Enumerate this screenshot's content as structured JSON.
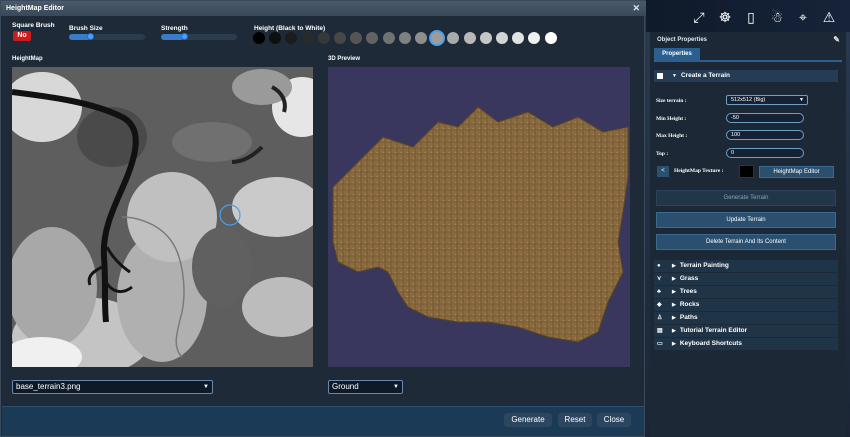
{
  "editor": {
    "title": "HeightMap Editor",
    "square_brush_label": "Square Brush",
    "square_brush_value": "No",
    "brush_size_label": "Brush Size",
    "brush_size_level": 0.28,
    "strength_label": "Strength",
    "strength_level": 0.3,
    "height_label": "Height (Black to White)",
    "height_swatches": [
      "#000000",
      "#0f0f0f",
      "#1c1c1c",
      "#2a2a2a",
      "#383838",
      "#474747",
      "#555555",
      "#636363",
      "#727272",
      "#808080",
      "#8e8e8e",
      "#9c9c9c",
      "#aaaaaa",
      "#b8b8b8",
      "#c6c6c6",
      "#d4d4d4",
      "#e2e2e2",
      "#f0f0f0",
      "#ffffff"
    ],
    "height_selected_index": 11,
    "heightmap_label": "HeightMap",
    "preview_label": "3D Preview",
    "file_select_value": "base_terrain3.png",
    "material_select_value": "Ground",
    "generate_label": "Generate",
    "reset_label": "Reset",
    "close_label": "Close"
  },
  "panel": {
    "title": "Object Properties",
    "tab_properties": "Properties",
    "create_terrain_label": "Create a Terrain",
    "size_terrain_label": "Size terrain :",
    "size_terrain_value": "512x512 (Big)",
    "min_height_label": "Min Height :",
    "min_height_value": "-50",
    "max_height_label": "Max Height :",
    "max_height_value": "100",
    "top_label": "Top :",
    "top_value": "0",
    "heightmap_texture_label": "HeightMap Texture :",
    "heightmap_editor_button": "HeightMap Editor",
    "generate_terrain_button": "Generate Terrain",
    "update_terrain_button": "Update Terrain",
    "delete_terrain_button": "Delete Terrain And Its Content",
    "sections": [
      "Terrain Painting",
      "Grass",
      "Trees",
      "Rocks",
      "Paths",
      "Tutorial Terrain Editor",
      "Keyboard Shortcuts"
    ]
  },
  "colors": {
    "accent": "#2a5f8f",
    "badge_red": "#cc1b1b",
    "preview_bg": "#39375e",
    "terrain_brown": "#8a6b40"
  },
  "icons": [
    "expand-icon",
    "brain-icon",
    "mobile-device-icon",
    "robot-icon",
    "camera-icon",
    "light-icon",
    "pin-icon"
  ]
}
